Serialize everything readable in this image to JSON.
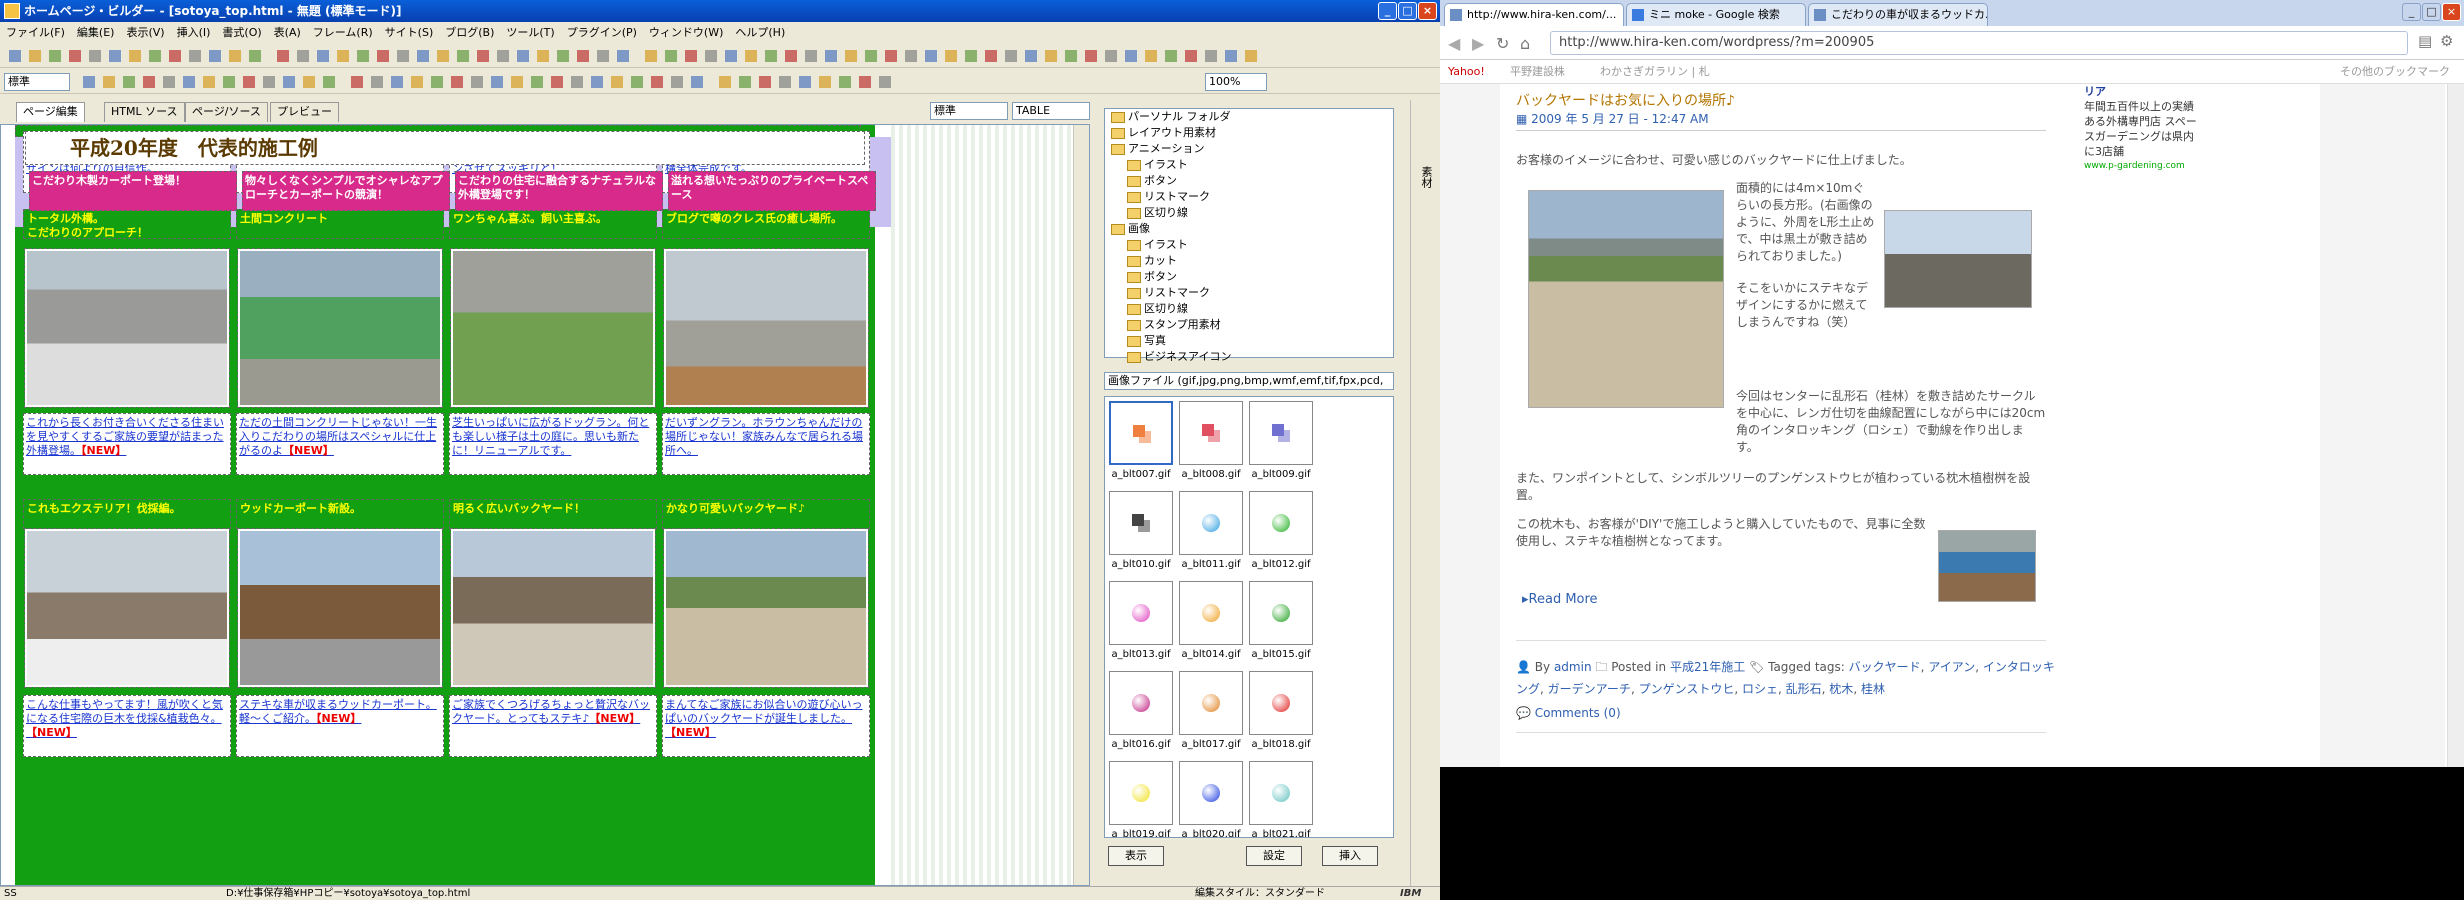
{
  "hpb": {
    "title": "ホームページ・ビルダー - [sotoya_top.html - 無題 (標準モード)]",
    "menu": [
      "ファイル(F)",
      "編集(E)",
      "表示(V)",
      "挿入(I)",
      "書式(O)",
      "表(A)",
      "フレーム(R)",
      "サイト(S)",
      "ブログ(B)",
      "ツール(T)",
      "プラグイン(P)",
      "ウィンドウ(W)",
      "ヘルプ(H)"
    ],
    "style_select": "標準",
    "zoom_select": "100%",
    "tabs": [
      "ページ編集",
      "HTML ソース",
      "ページ/ソース",
      "プレビュー"
    ],
    "mode_select": "標準",
    "table_select": "TABLE",
    "top_blurbs": [
      "アプローチやプライベートエリアにこだわりアリ！お話しながら決め手の外構デザインは何よりの自信作。",
      "今回は外構全体プランの下地みのみお手伝い。色々ご相談下さい。",
      "家族にも遊ばれる(？)…そんな池の改修です。大きな池をちょっとスケールダウンさせてスッキリと！",
      "滝川市の外構工事。カーポートを軸としてアプローチを明るい感じで仕上げ、外構全体完成です。"
    ],
    "row1_heads": [
      "トータル外構。\nこだわりのアプローチ！",
      "土間コンクリート",
      "ワンちゃん喜ぶ。飼い主喜ぶ。",
      "ブログで噂のクレス氏の癒し場所。"
    ],
    "row1_blurbs": [
      "これから長くお付き合いくださる住まいを見やすくするご家族の要望が詰まった外構登場。【NEW】",
      "ただの土間コンクリートじゃない！一生入りこだわりの場所はスペシャルに仕上がるのよ【NEW】",
      "芝生いっぱいに広がるドッグラン。何とも楽しい様子は土の庭に。思いも新たに！リニューアルです。",
      "だいずングラン。ホラウンちゃんだけの場所じゃない！家族みんなで居られる場所へ。"
    ],
    "row2_heads": [
      "これもエクステリア！伐採編。",
      "ウッドカーポート新設。",
      "明るく広いバックヤード！",
      "かなり可愛いバックヤード♪"
    ],
    "row2_blurbs": [
      "こんな仕事もやってます！風が吹くと気になる住宅際の巨木を伐採&植栽色々。【NEW】",
      "ステキな車が収まるウッドカーポート。軽〜くご紹介。【NEW】",
      "ご家族でくつろげるちょっと贅沢なバックヤード。とってもステキ♪【NEW】",
      "まんてなご家族にお似合いの遊び心いっぱいのバックヤードが誕生しました。【NEW】"
    ],
    "section_title": "平成20年度　代表的施工例",
    "bottom_heads": [
      "こだわり木製カーポート登場！",
      "物々しくなくシンプルでオシャレなアプローチとカーポートの競演！",
      "こだわりの住宅に融合するナチュラルな外構登場です！",
      "溢れる想いたっぷりのプライベートスペース"
    ],
    "status_path": "D:¥仕事保存箱¥HPコピー¥sotoya¥sotoya_top.html",
    "status_left": "SS",
    "status_right": "編集スタイル：スタンダード",
    "ibm": "IBM",
    "panel_tree": [
      "パーソナル フォルダ",
      "レイアウト用素材",
      "アニメーション",
      "イラスト",
      "ボタン",
      "リストマーク",
      "区切り線",
      "画像",
      "イラスト",
      "カット",
      "ボタン",
      "リストマーク",
      "区切り線",
      "スタンプ用素材",
      "写真",
      "ビジネスアイコン"
    ],
    "panel_filetypes": "画像ファイル (gif,jpg,png,bmp,wmf,emf,tif,fpx,pcd,",
    "thumbs": [
      "a_blt007.gif",
      "a_blt008.gif",
      "a_blt009.gif",
      "a_blt010.gif",
      "a_blt011.gif",
      "a_blt012.gif",
      "a_blt013.gif",
      "a_blt014.gif",
      "a_blt015.gif",
      "a_blt016.gif",
      "a_blt017.gif",
      "a_blt018.gif",
      "a_blt019.gif",
      "a_blt020.gif",
      "a_blt021.gif"
    ],
    "thumb_colors": [
      "#f08040",
      "#e05060",
      "#7070d0",
      "#444444",
      "#30a0e0",
      "#20b020",
      "#e040c0",
      "#f0a020",
      "#20a020",
      "#c02080",
      "#e08020",
      "#e02020",
      "#f0e020",
      "#2040e0",
      "#60c0c0"
    ],
    "panel_buttons": [
      "表示",
      "設定",
      "挿入"
    ],
    "side_strip_label": "素材"
  },
  "browser": {
    "tabs": [
      "http://www.hira-ken.com/...",
      "ミニ moke - Google 検索",
      "こだわりの車が収まるウッドカ..."
    ],
    "url": "http://www.hira-ken.com/wordpress/?m=200905",
    "bookmarks": [
      "Yahoo!",
      "平野建設株",
      "わかさぎガラリン | 札",
      "その他のブックマーク"
    ],
    "post": {
      "title": "バックヤードはお気に入りの場所♪",
      "date": "2009 年 5 月 27 日 - 12:47 AM",
      "intro": "お客様のイメージに合わせ、可愛い感じのバックヤードに仕上げました。",
      "p1": "面積的には4m×10mぐらいの長方形。(右画像のように、外周をL形土止めで、中は黒土が敷き詰められておりました。)",
      "p2": "そこをいかにステキなデザインにするかに燃えてしまうんですね（笑）",
      "p3": "今回はセンターに乱形石（桂林）を敷き詰めたサークルを中心に、レンガ仕切を曲線配置にしながら中には20cm角のインタロッキング（ロシェ）で動線を作り出します。",
      "p4": "また、ワンポイントとして、シンボルツリーのプンゲンストウヒが植わっている枕木植樹桝を設置。",
      "p5": "この枕木も、お客様が'DIY'で施工しようと購入していたもので、見事に全数使用し、ステキな植樹桝となってます。",
      "read_more": "Read More",
      "meta_by": "By",
      "author": "admin",
      "posted_in": "Posted in",
      "category": "平成21年施工",
      "tagged": "Tagged tags:",
      "tags": [
        "バックヤード",
        "アイアン",
        "インタロッキング",
        "ガーデンアーチ",
        "プンゲンストウヒ",
        "ロシェ",
        "乱形石",
        "枕木",
        "桂林"
      ],
      "comments": "Comments (0)"
    },
    "sidebar": {
      "title": "リア",
      "text": "年間五百件以上の実績ある外構専門店 スペースガーデニングは県内に3店舗",
      "link": "www.p-gardening.com"
    }
  }
}
